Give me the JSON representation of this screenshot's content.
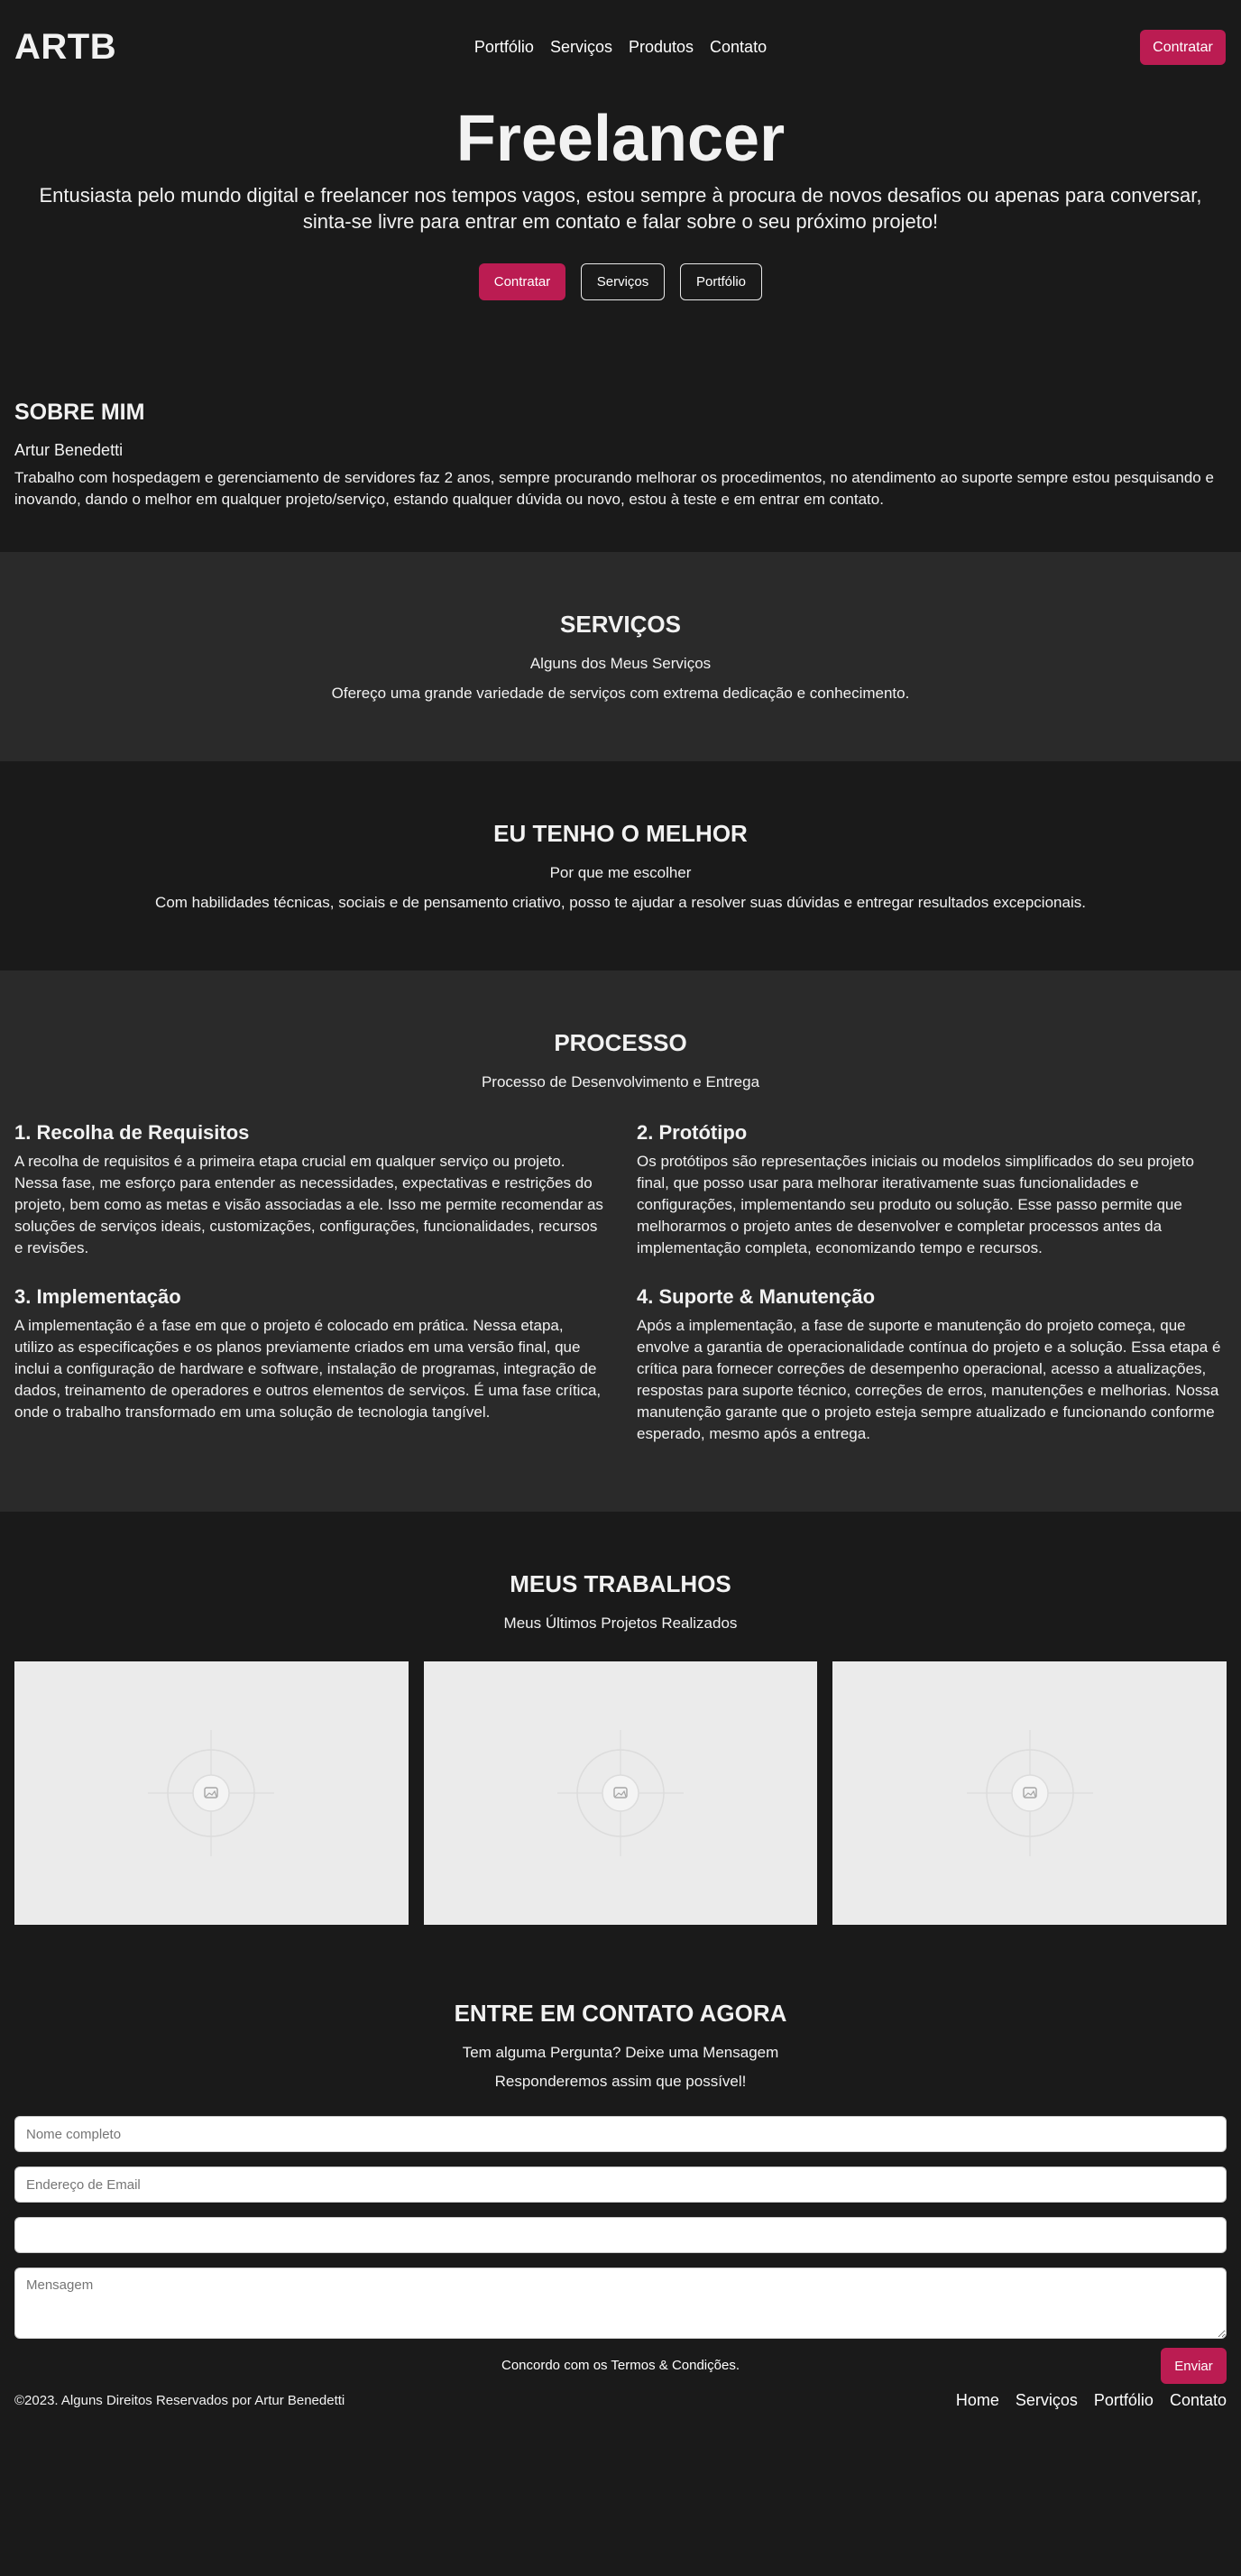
{
  "header": {
    "logo": "ARTB",
    "nav": [
      "Portfólio",
      "Serviços",
      "Produtos",
      "Contato"
    ],
    "cta": "Contratar"
  },
  "hero": {
    "title": "Freelancer",
    "subtitle": "Entusiasta pelo mundo digital e freelancer nos tempos vagos, estou sempre à procura de novos desafios ou apenas para conversar, sinta-se livre para entrar em contato e falar sobre o seu próximo projeto!",
    "buttons": [
      "Contratar",
      "Serviços",
      "Portfólio"
    ]
  },
  "about": {
    "title": "SOBRE MIM",
    "name": "Artur Benedetti",
    "text": "Trabalho com hospedagem e gerenciamento de servidores faz 2 anos, sempre procurando melhorar os procedimentos, no atendimento ao suporte sempre estou pesquisando e inovando, dando o melhor em qualquer projeto/serviço, estando qualquer dúvida ou novo, estou à teste e em entrar em contato."
  },
  "services": {
    "title": "SERVIÇOS",
    "subtitle": "Alguns dos Meus Serviços",
    "description": "Ofereço uma grande variedade de serviços com extrema dedicação e conhecimento."
  },
  "best": {
    "title": "EU TENHO O MELHOR",
    "subtitle": "Por que me escolher",
    "description": "Com habilidades técnicas, sociais e de pensamento criativo, posso te ajudar a resolver suas dúvidas e entregar resultados excepcionais."
  },
  "process": {
    "title": "PROCESSO",
    "subtitle": "Processo de Desenvolvimento e Entrega",
    "steps": [
      {
        "title": "1. Recolha de Requisitos",
        "text": "A recolha de requisitos é a primeira etapa crucial em qualquer serviço ou projeto. Nessa fase, me esforço para entender as necessidades, expectativas e restrições do projeto, bem como as metas e visão associadas a ele. Isso me permite recomendar as soluções de serviços ideais, customizações, configurações, funcionalidades, recursos e revisões."
      },
      {
        "title": "2. Protótipo",
        "text": "Os protótipos são representações iniciais ou modelos simplificados do seu projeto final, que posso usar para melhorar iterativamente suas funcionalidades e configurações, implementando seu produto ou solução. Esse passo permite que melhorarmos o projeto antes de desenvolver e completar processos antes da implementação completa, economizando tempo e recursos."
      },
      {
        "title": "3. Implementação",
        "text": "A implementação é a fase em que o projeto é colocado em prática. Nessa etapa, utilizo as especificações e os planos previamente criados em uma versão final, que inclui a configuração de hardware e software, instalação de programas, integração de dados, treinamento de operadores e outros elementos de serviços. É uma fase crítica, onde o trabalho transformado em uma solução de tecnologia tangível."
      },
      {
        "title": "4. Suporte & Manutenção",
        "text": "Após a implementação, a fase de suporte e manutenção do projeto começa, que envolve a garantia de operacionalidade contínua do projeto e a solução. Essa etapa é crítica para fornecer correções de desempenho operacional, acesso a atualizações, respostas para suporte técnico, correções de erros, manutenções e melhorias. Nossa manutenção garante que o projeto esteja sempre atualizado e funcionando conforme esperado, mesmo após a entrega."
      }
    ]
  },
  "works": {
    "title": "MEUS TRABALHOS",
    "subtitle": "Meus Últimos Projetos Realizados",
    "items": 3
  },
  "contact": {
    "title": "ENTRE EM CONTATO AGORA",
    "subtitle": "Tem alguma Pergunta? Deixe uma Mensagem",
    "description": "Responderemos assim que possível!",
    "name_placeholder": "Nome completo",
    "email_placeholder": "Endereço de Email",
    "phone_placeholder": "",
    "message_placeholder": "Mensagem",
    "terms": "Concordo com os Termos & Condições.",
    "submit": "Enviar"
  },
  "footer": {
    "copyright": "©2023. Alguns Direitos Reservados por Artur Benedetti",
    "nav": [
      "Home",
      "Serviços",
      "Portfólio",
      "Contato"
    ]
  },
  "colors": {
    "background": "#1a1a1a",
    "alt_background": "#2a2a2a",
    "accent": "#bb1c52"
  }
}
